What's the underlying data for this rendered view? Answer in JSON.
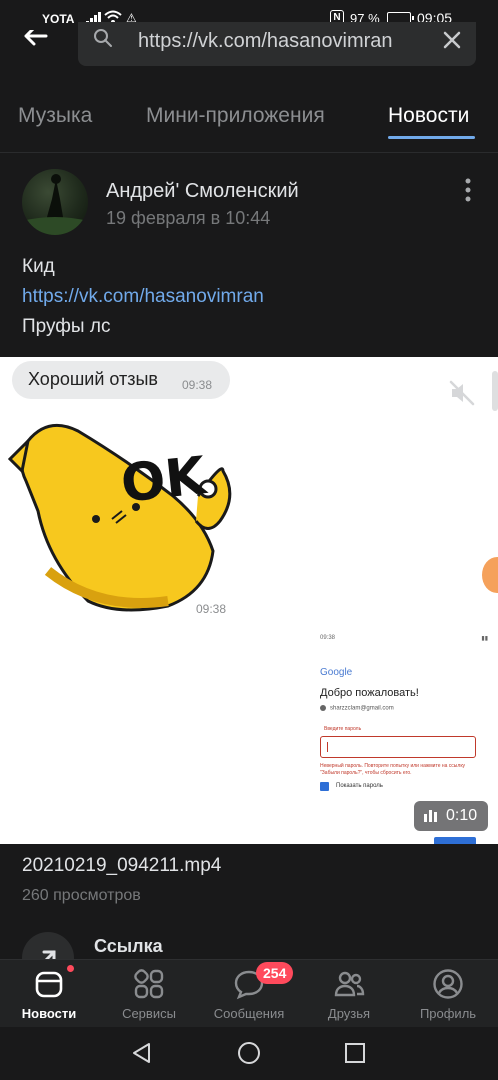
{
  "status_bar": {
    "carrier": "YOTA",
    "nfc": "N",
    "battery_percent": "97 %",
    "battery_level": 0.97,
    "time": "09:05"
  },
  "browser": {
    "url": "https://vk.com/hasanovimran",
    "back_icon": "arrow-left-icon",
    "search_icon": "search-icon",
    "clear_icon": "close-icon"
  },
  "tabs": [
    {
      "label": "Музыка",
      "active": false
    },
    {
      "label": "Мини-приложения",
      "active": false
    },
    {
      "label": "Новости",
      "active": true
    }
  ],
  "post": {
    "author": "Андрей' Смоленский",
    "date": "19 февраля в 10:44",
    "text_line1": "Кид",
    "text_link": "https://vk.com/hasanovimran",
    "text_line3": "Пруфы лс",
    "video": {
      "bubble_text": "Хороший отзыв",
      "bubble_time": "09:38",
      "sticker_text": "OK",
      "sticker_time": "09:38",
      "shot_google": "Google",
      "shot_welcome": "Добро пожаловать!",
      "shot_email": "sharzzclam@gmail.com",
      "shot_password_label": "Введите пароль",
      "shot_error": "Неверный пароль. Повторите попытку или нажмите на ссылку \"Забыли пароль?\", чтобы сбросить его.",
      "shot_show_password": "Показать пароль",
      "shot_time": "09:38",
      "duration": "0:10"
    },
    "video_name": "20210219_094211.mp4",
    "views": "260 просмотров",
    "link_label": "Ссылка"
  },
  "bottom_nav": [
    {
      "label": "Новости",
      "icon": "news-icon",
      "active": true
    },
    {
      "label": "Сервисы",
      "icon": "services-icon",
      "active": false
    },
    {
      "label": "Сообщения",
      "icon": "messages-icon",
      "active": false,
      "badge": "254"
    },
    {
      "label": "Друзья",
      "icon": "friends-icon",
      "active": false
    },
    {
      "label": "Профиль",
      "icon": "profile-icon",
      "active": false
    }
  ],
  "colors": {
    "background": "#19191a",
    "accent": "#71aaeb",
    "badge": "#ff4a5c"
  }
}
